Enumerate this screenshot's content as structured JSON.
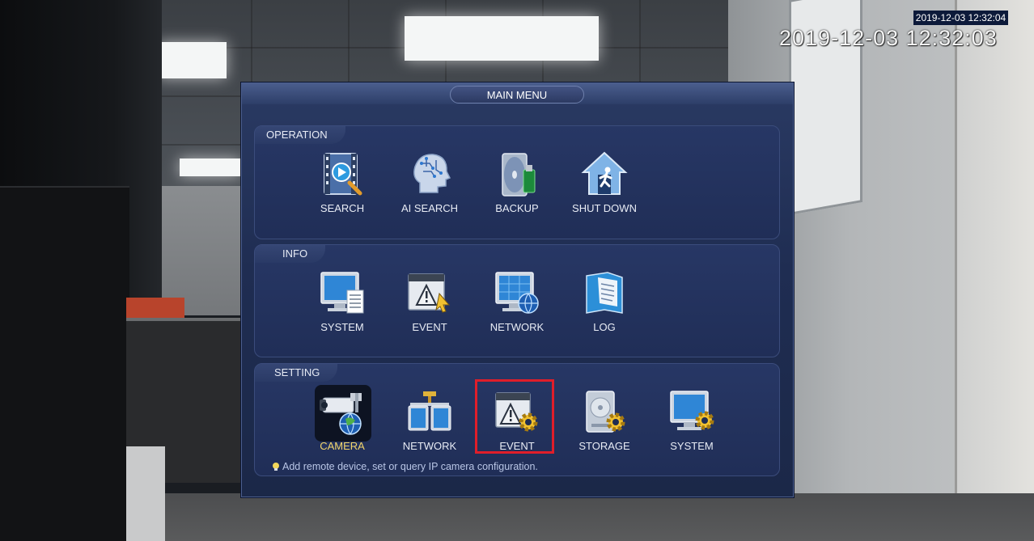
{
  "osd": {
    "timestamp_small": "2019-12-03 12:32:04",
    "timestamp_large": "2019-12-03 12:32:03"
  },
  "menu": {
    "title": "MAIN MENU",
    "sections": {
      "operation": {
        "label": "OPERATION",
        "items": [
          {
            "label": "SEARCH",
            "icon": "film-search-icon"
          },
          {
            "label": "AI SEARCH",
            "icon": "ai-head-icon"
          },
          {
            "label": "BACKUP",
            "icon": "backup-disk-icon"
          },
          {
            "label": "SHUT DOWN",
            "icon": "shutdown-house-icon"
          }
        ]
      },
      "info": {
        "label": "INFO",
        "items": [
          {
            "label": "SYSTEM",
            "icon": "monitor-doc-icon"
          },
          {
            "label": "EVENT",
            "icon": "event-warning-icon"
          },
          {
            "label": "NETWORK",
            "icon": "network-globe-icon"
          },
          {
            "label": "LOG",
            "icon": "log-book-icon"
          }
        ]
      },
      "setting": {
        "label": "SETTING",
        "items": [
          {
            "label": "CAMERA",
            "icon": "camera-globe-icon",
            "active": true
          },
          {
            "label": "NETWORK",
            "icon": "network-monitors-icon"
          },
          {
            "label": "EVENT",
            "icon": "event-gear-icon",
            "highlighted": true
          },
          {
            "label": "STORAGE",
            "icon": "storage-gear-icon"
          },
          {
            "label": "SYSTEM",
            "icon": "monitor-gear-icon"
          }
        ]
      }
    },
    "hint": "Add remote device, set or query IP camera configuration."
  },
  "colors": {
    "panel": "#1f2d52",
    "section": "#273765",
    "active_label": "#f2d56a",
    "highlight_box": "#e01e2a"
  }
}
